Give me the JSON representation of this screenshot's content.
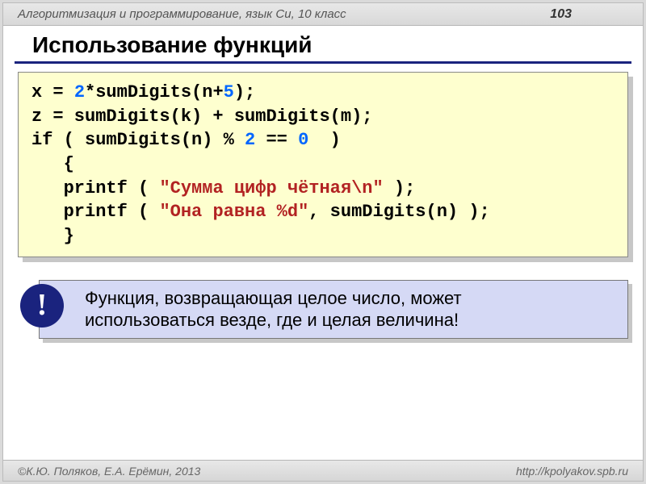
{
  "header": {
    "course": "Алгоритмизация и программирование, язык Си, 10 класс",
    "page": "103"
  },
  "title": "Использование функций",
  "code": {
    "l1a": "x = ",
    "l1n1": "2",
    "l1b": "*sumDigits(n+",
    "l1n2": "5",
    "l1c": ");",
    "l2": "z = sumDigits(k) + sumDigits(m);",
    "l3a": "if ( sumDigits(n) % ",
    "l3n1": "2",
    "l3b": " == ",
    "l3n2": "0",
    "l3c": "  )",
    "l4": "   {",
    "l5a": "   printf ( ",
    "l5s": "\"Сумма цифр чётная\\n\"",
    "l5b": " );",
    "l6a": "   printf ( ",
    "l6s": "\"Она равна %d\"",
    "l6b": ", sumDigits(n) );",
    "l7": "   }"
  },
  "callout": {
    "mark": "!",
    "line1": "Функция, возвращающая целое число, может",
    "line2": "использоваться везде, где и целая величина!"
  },
  "footer": {
    "authors": "К.Ю. Поляков, Е.А. Ерёмин, 2013",
    "url": "http://kpolyakov.spb.ru"
  }
}
